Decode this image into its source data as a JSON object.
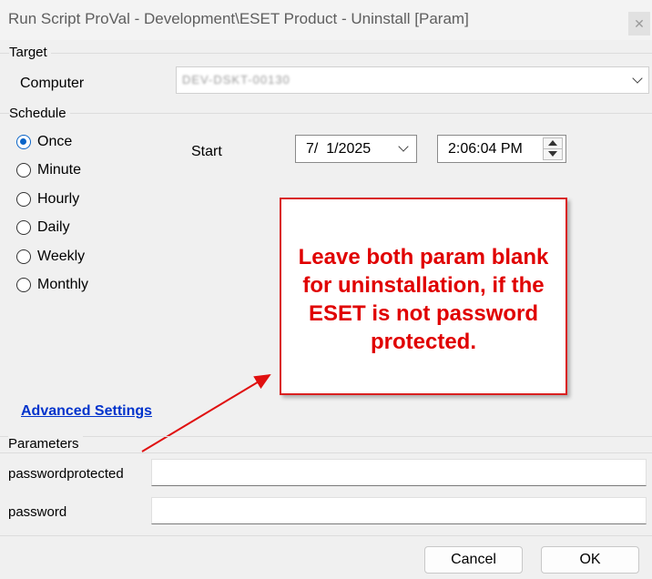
{
  "window": {
    "title": "Run Script ProVal - Development\\ESET Product - Uninstall [Param]",
    "close_glyph": "✕"
  },
  "target": {
    "section_label": "Target",
    "computer_label": "Computer",
    "computer_value": "DEV-DSKT-00130"
  },
  "schedule": {
    "section_label": "Schedule",
    "options": [
      {
        "label": "Once",
        "checked": true
      },
      {
        "label": "Minute",
        "checked": false
      },
      {
        "label": "Hourly",
        "checked": false
      },
      {
        "label": "Daily",
        "checked": false
      },
      {
        "label": "Weekly",
        "checked": false
      },
      {
        "label": "Monthly",
        "checked": false
      }
    ],
    "start_label": "Start",
    "start_date": "7/  1/2025",
    "start_time": "2:06:04 PM"
  },
  "annotation": {
    "text": "Leave both param blank for uninstallation, if the ESET is not password protected.",
    "color": "#e00000"
  },
  "advanced_settings_label": "Advanced Settings",
  "parameters": {
    "section_label": "Parameters",
    "fields": [
      {
        "label": "passwordprotected",
        "value": ""
      },
      {
        "label": "password",
        "value": ""
      }
    ]
  },
  "buttons": {
    "cancel": "Cancel",
    "ok": "OK"
  }
}
